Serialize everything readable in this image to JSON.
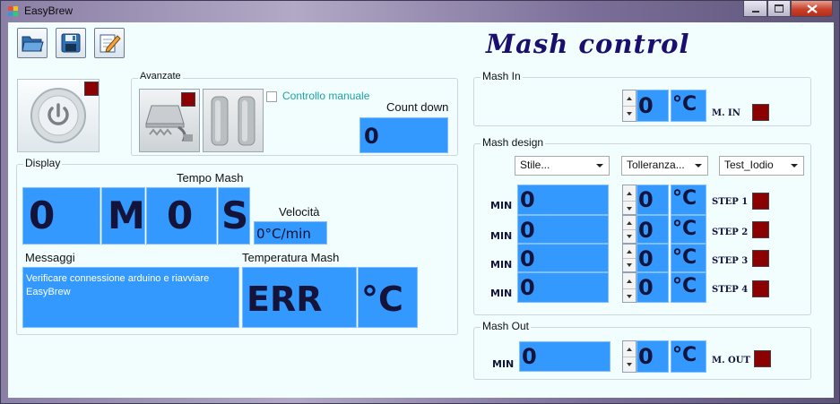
{
  "window": {
    "title": "EasyBrew"
  },
  "colors": {
    "field_blue": "#3399ff",
    "indicator_red": "#8b0000",
    "title_navy": "#1a0f6e"
  },
  "toolbar": {
    "icons": [
      "folder-open-icon",
      "save-icon",
      "edit-icon"
    ]
  },
  "app_title": "Mash control",
  "avanzate": {
    "label": "Avanzate",
    "manual_label": "Controllo manuale",
    "countdown_label": "Count down",
    "countdown_value": "0"
  },
  "display": {
    "label": "Display",
    "tempo_label": "Tempo Mash",
    "min_value": "0",
    "min_unit": "M",
    "sec_value": "0",
    "sec_unit": "S",
    "velocita_label": "Velocità",
    "velocita_value": "0°C/min",
    "messaggi_label": "Messaggi",
    "messaggi_text": "Verificare connessione arduino e riavviare EasyBrew",
    "temp_label": "Temperatura Mash",
    "temp_value": "ERR",
    "temp_unit": "°C"
  },
  "mash_in": {
    "label": "Mash In",
    "value": "0",
    "unit": "°C",
    "tag": "M. IN"
  },
  "mash_design": {
    "label": "Mash design",
    "combos": [
      "Stile...",
      "Tolleranza...",
      "Test_Iodio"
    ],
    "steps": [
      {
        "min_label": "MIN",
        "minutes": "0",
        "temp": "0",
        "unit": "°C",
        "tag": "STEP 1"
      },
      {
        "min_label": "MIN",
        "minutes": "0",
        "temp": "0",
        "unit": "°C",
        "tag": "STEP 2"
      },
      {
        "min_label": "MIN",
        "minutes": "0",
        "temp": "0",
        "unit": "°C",
        "tag": "STEP 3"
      },
      {
        "min_label": "MIN",
        "minutes": "0",
        "temp": "0",
        "unit": "°C",
        "tag": "STEP 4"
      }
    ]
  },
  "mash_out": {
    "label": "Mash Out",
    "min_label": "MIN",
    "minutes": "0",
    "temp": "0",
    "unit": "°C",
    "tag": "M. OUT"
  }
}
